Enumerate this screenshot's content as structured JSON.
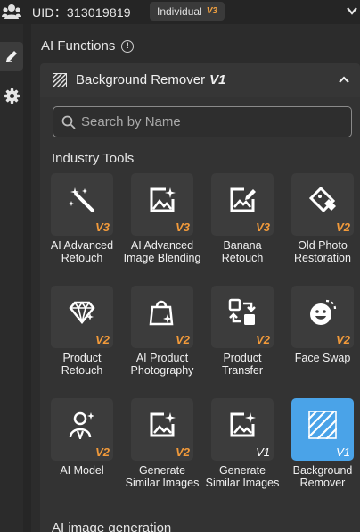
{
  "header": {
    "uid_text": "UID：313019819",
    "badge_label": "Individual",
    "badge_version": "V3"
  },
  "panel": {
    "title": "AI Functions",
    "section_title": "Background Remover",
    "section_version": "V1",
    "search_placeholder": "Search by Name",
    "categories": [
      "Industry Tools",
      "AI image generation"
    ]
  },
  "tools": [
    {
      "label": "AI Advanced Retouch",
      "version": "V3",
      "icon": "magic-wand-icon"
    },
    {
      "label": "AI Advanced Image Blending",
      "version": "V3",
      "icon": "image-blend-icon"
    },
    {
      "label": "Banana Retouch",
      "version": "V3",
      "icon": "image-edit-icon"
    },
    {
      "label": "Old Photo Restoration",
      "version": "V2",
      "icon": "photo-restore-icon"
    },
    {
      "label": "Product Retouch",
      "version": "V2",
      "icon": "diamond-sparkle-icon"
    },
    {
      "label": "AI Product Photography",
      "version": "V2",
      "icon": "shopping-bag-icon"
    },
    {
      "label": "Product Transfer",
      "version": "V2",
      "icon": "transfer-icon"
    },
    {
      "label": "Face Swap",
      "version": "V2",
      "icon": "face-swap-icon"
    },
    {
      "label": "AI Model",
      "version": "V2",
      "icon": "model-person-icon"
    },
    {
      "label": "Generate Similar Images",
      "version": "V2",
      "icon": "similar-image-icon"
    },
    {
      "label": "Generate Similar Images",
      "version": "V1",
      "icon": "similar-image-icon"
    },
    {
      "label": "Background Remover",
      "version": "V1",
      "icon": "stripes-icon",
      "selected": true
    }
  ]
}
